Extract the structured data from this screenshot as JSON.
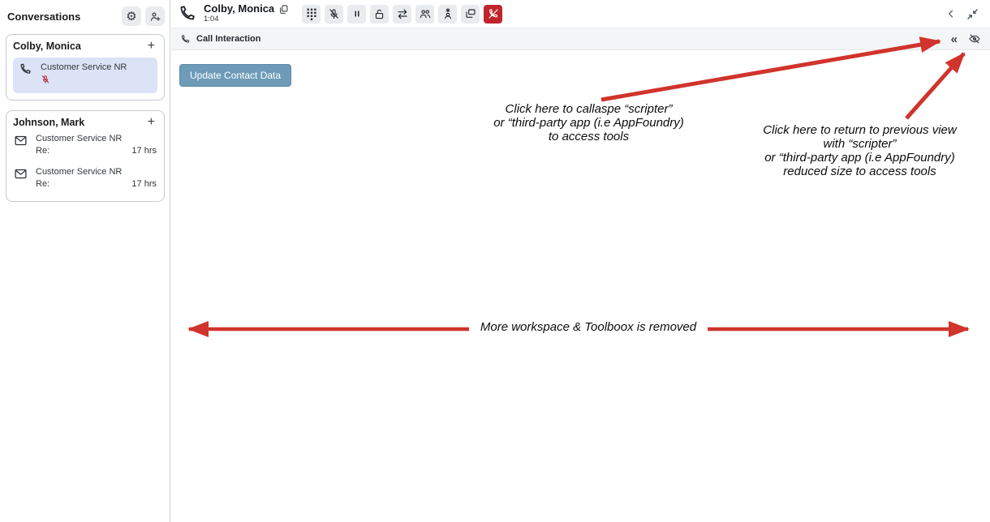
{
  "sidebar": {
    "title": "Conversations",
    "cards": [
      {
        "contact": "Colby, Monica",
        "add_button": "+",
        "interactions": [
          {
            "type": "call",
            "queue": "Customer Service NR",
            "muted": true
          }
        ]
      },
      {
        "contact": "Johnson, Mark",
        "add_button": "+",
        "interactions": [
          {
            "type": "email",
            "queue": "Customer Service NR",
            "subject_prefix": "Re:",
            "age": "17 hrs"
          },
          {
            "type": "email",
            "queue": "Customer Service NR",
            "subject_prefix": "Re:",
            "age": "17 hrs"
          }
        ]
      }
    ]
  },
  "call_header": {
    "contact_name": "Colby, Monica",
    "call_timer": "1:04",
    "tools": [
      "dialpad",
      "mute",
      "hold",
      "secure-pause",
      "transfer",
      "consult",
      "conference",
      "apps",
      "end-call"
    ]
  },
  "interaction_panel": {
    "title": "Call Interaction",
    "collapse_glyph": "«",
    "update_contact_button": "Update Contact Data"
  },
  "annotations": {
    "collapse_note_lines": [
      "Click here to callaspe “scripter”",
      "or  “third-party app (i.e AppFoundry)",
      "to access tools"
    ],
    "return_note_lines": [
      "Click here to return to previous view",
      "with “scripter”",
      "or  “third-party app (i.e AppFoundry)",
      "reduced size to access tools"
    ],
    "workspace_note": "More workspace & Toolboox is removed"
  },
  "icons": {
    "gear-icon": "settings gear",
    "add-person-icon": "add participant",
    "phone-icon": "voice call handset",
    "mic-muted-icon": "microphone with slash",
    "envelope-icon": "email envelope",
    "copy-icon": "copy name",
    "dialpad-icon": "keypad dots",
    "pause-icon": "hold bars",
    "lock-open-icon": "secure pause unlocked",
    "transfer-icon": "two horizontal arrows",
    "consult-icon": "two people",
    "conference-icon": "person with star",
    "apps-icon": "overlapping windows",
    "end-call-icon": "handset with slash",
    "chevron-left-icon": "collapse panel left",
    "compress-icon": "reduce window size",
    "double-chevron-icon": "collapse toolbox",
    "eye-slash-icon": "hide panel"
  },
  "colors": {
    "update_button_bg": "#6d9bb8",
    "end_call_bg": "#c0242c",
    "selected_interaction_bg": "#dde3f6",
    "toolbar_button_bg": "#e9ebef",
    "interaction_bar_bg": "#f4f5f7",
    "arrow_red": "#d0342c"
  }
}
